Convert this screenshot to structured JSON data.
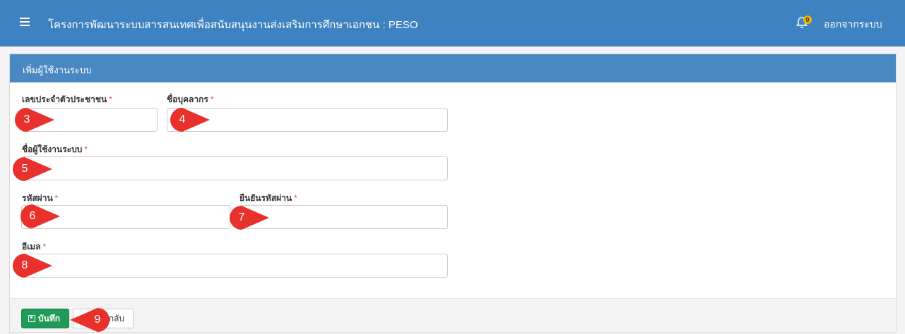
{
  "navbar": {
    "menu_icon": "hamburger-icon",
    "title": "โครงการพัฒนาระบบสารสนเทศเพื่อสนับสนุนงานส่งเสริมการศึกษาเอกชน : PESO",
    "bell_icon": "bell-icon",
    "notification_count": "0",
    "logout_label": "ออกจากระบบ"
  },
  "panel": {
    "heading": "เพิ่มผู้ใช้งานระบบ"
  },
  "form": {
    "required_mark": "*",
    "citizen_id": {
      "label": "เลขประจำตัวประชาชน",
      "value": ""
    },
    "personnel_name": {
      "label": "ชื่อบุคลากร",
      "value": ""
    },
    "username": {
      "label": "ชื่อผู้ใช้งานระบบ",
      "value": ""
    },
    "password": {
      "label": "รหัสผ่าน",
      "value": ""
    },
    "confirm_password": {
      "label": "ยืนยันรหัสผ่าน",
      "value": ""
    },
    "email": {
      "label": "อีเมล",
      "value": ""
    }
  },
  "buttons": {
    "save_label": "บันทึก",
    "save_icon": "floppy-disk-icon",
    "back_label": "กลับ"
  },
  "markers": [
    "3",
    "4",
    "5",
    "6",
    "7",
    "8",
    "9"
  ],
  "colors": {
    "navbar": "#3f82c1",
    "panel_heading": "#4a88c3",
    "marker": "#e8312c",
    "save_button": "#1f9a57",
    "required": "#d9534f"
  }
}
